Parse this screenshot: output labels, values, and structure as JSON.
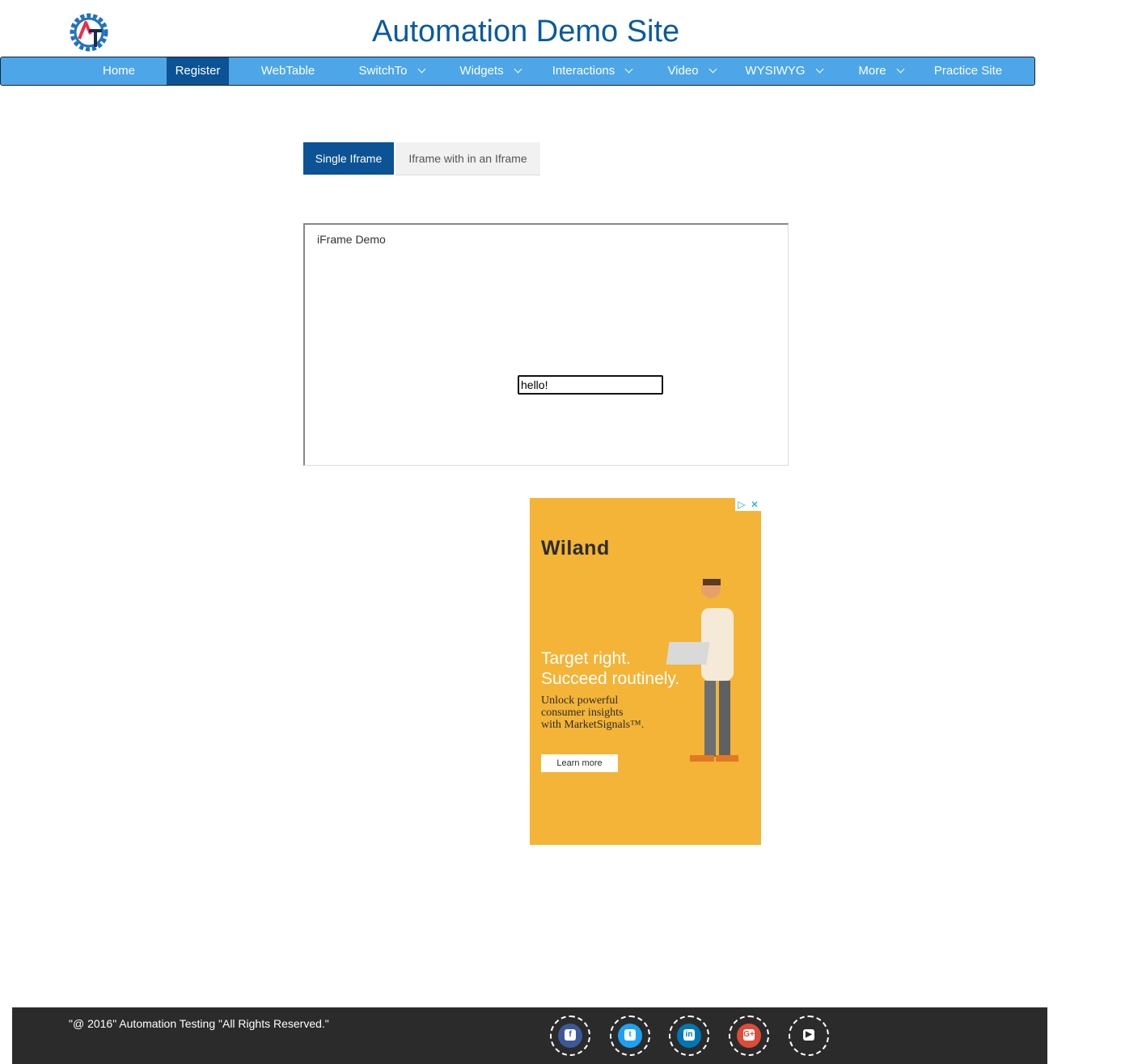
{
  "header": {
    "site_title": "Automation Demo Site",
    "logo_icon": "automation-testing-logo",
    "logo_colors": {
      "gear": "#1e73be",
      "a": "#e8304a",
      "t": "#1b2a4a"
    }
  },
  "nav": {
    "items": [
      {
        "label": "Home",
        "dropdown": false
      },
      {
        "label": "Register",
        "dropdown": false,
        "active": true
      },
      {
        "label": "WebTable",
        "dropdown": false
      },
      {
        "label": "SwitchTo",
        "dropdown": true
      },
      {
        "label": "Widgets",
        "dropdown": true
      },
      {
        "label": "Interactions",
        "dropdown": true
      },
      {
        "label": "Video",
        "dropdown": true
      },
      {
        "label": "WYSIWYG",
        "dropdown": true
      },
      {
        "label": "More",
        "dropdown": true
      },
      {
        "label": "Practice Site",
        "dropdown": false
      }
    ],
    "colors": {
      "bar": "#4da6e8",
      "active": "#0b5394"
    }
  },
  "tabs": [
    {
      "label": "Single Iframe",
      "active": true
    },
    {
      "label": "Iframe with in an Iframe",
      "active": false
    }
  ],
  "iframe": {
    "label": "iFrame Demo",
    "input_value": "hello!"
  },
  "ad": {
    "brand": "Wiland",
    "headline_1": "Target right.",
    "headline_2": "Succeed routinely.",
    "sub_1": "Unlock powerful",
    "sub_2": "consumer insights",
    "sub_3": "with MarketSignals™.",
    "button": "Learn more",
    "background": "#f3b437"
  },
  "footer": {
    "copyright": "\"@ 2016\" Automation Testing \"All Rights Reserved.\"",
    "social": [
      {
        "icon": "facebook-icon",
        "color": "#3b5998",
        "glyph": "f"
      },
      {
        "icon": "twitter-icon",
        "color": "#1da1f2",
        "glyph": "t"
      },
      {
        "icon": "linkedin-icon",
        "color": "#0077b5",
        "glyph": "in"
      },
      {
        "icon": "google-plus-icon",
        "color": "#dd4b39",
        "glyph": "G+"
      },
      {
        "icon": "youtube-icon",
        "color": "#2b2b2b",
        "glyph": "▶"
      }
    ]
  }
}
